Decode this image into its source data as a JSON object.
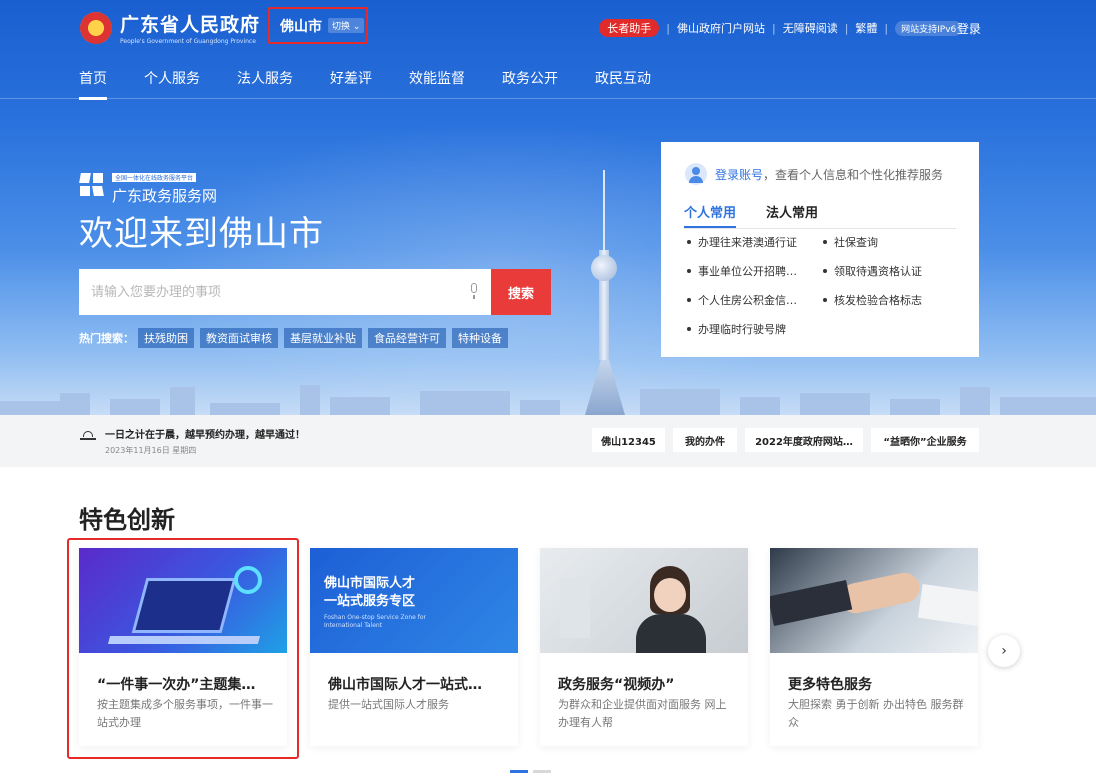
{
  "header": {
    "logo_cn": "广东省人民政府",
    "logo_en": "People's Government of Guangdong Province",
    "city": "佛山市",
    "switch_label": "切换",
    "links": [
      "长者助手",
      "佛山政府门户网站",
      "无障碍阅读",
      "繁體",
      "网站支持IPv6"
    ],
    "login": "登录"
  },
  "nav": [
    "首页",
    "个人服务",
    "法人服务",
    "好差评",
    "效能监督",
    "政务公开",
    "政民互动"
  ],
  "hero": {
    "platform_small": "全国一体化在线政务服务平台",
    "platform_name": "广东政务服务网",
    "welcome": "欢迎来到佛山市",
    "search_placeholder": "请输入您要办理的事项",
    "search_button": "搜索",
    "hot_label": "热门搜索：",
    "hot_tags": [
      "扶残助困",
      "教资面试审核",
      "基层就业补贴",
      "食品经营许可",
      "特种设备"
    ]
  },
  "login_card": {
    "login_link": "登录账号",
    "login_text": "，查看个人信息和个性化推荐服务",
    "tabs": [
      "个人常用",
      "法人常用"
    ],
    "services": [
      "办理往来港澳通行证",
      "社保查询",
      "事业单位公开招聘…",
      "领取待遇资格认证",
      "个人住房公积金信…",
      "核发检验合格标志",
      "办理临时行驶号牌"
    ]
  },
  "notice": {
    "message": "一日之计在于晨，越早预约办理，越早通过！",
    "date": "2023年11月16日 星期四",
    "quick_links": [
      "佛山12345",
      "我的办件",
      "2022年度政府网站…",
      "“益晒你”企业服务"
    ]
  },
  "features": {
    "title": "特色创新",
    "cards": [
      {
        "title": "“一件事一次办”主题集…",
        "desc": "按主题集成多个服务事项，一件事一站式办理"
      },
      {
        "title": "佛山市国际人才一站式…",
        "desc": "提供一站式国际人才服务",
        "img_text_1": "佛山市国际人才",
        "img_text_2": "一站式服务专区",
        "img_text_en": "Foshan One-stop Service Zone for International Talent"
      },
      {
        "title": "政务服务“视频办”",
        "desc": "为群众和企业提供面对面服务 网上办理有人帮"
      },
      {
        "title": "更多特色服务",
        "desc": "大胆探索 勇于创新 办出特色 服务群众"
      }
    ]
  },
  "colors": {
    "primary": "#2f73e0",
    "accent_red": "#ea3b3b",
    "highlight": "#e62a2a"
  }
}
